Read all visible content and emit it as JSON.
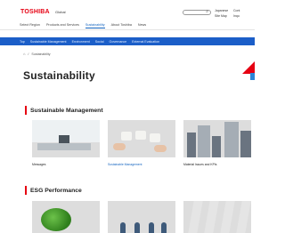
{
  "header": {
    "logo_text": "TOSHIBA",
    "region_label": "Global",
    "search_placeholder": "",
    "utility_links": [
      "Japanese",
      "Site Map",
      "Cont",
      "Inqu"
    ]
  },
  "nav": {
    "items": [
      "Select Region",
      "Products and Services",
      "Sustainability",
      "About Toshiba",
      "News"
    ],
    "active_index": 2
  },
  "subnav": {
    "items": [
      "Top",
      "Sustainable Management",
      "Environment",
      "Social",
      "Governance",
      "External Evaluation"
    ]
  },
  "breadcrumb": {
    "home_icon": "home-icon",
    "current": "Sustainability"
  },
  "page": {
    "title": "Sustainability"
  },
  "sections": [
    {
      "title": "Sustainable Management",
      "cards": [
        {
          "label": "Messages",
          "is_link": false
        },
        {
          "label": "Sustainable Management",
          "is_link": true
        },
        {
          "label": "Material Issues and KPIs",
          "is_link": false
        }
      ]
    },
    {
      "title": "ESG Performance",
      "cards": [
        {
          "label": "",
          "is_link": false
        },
        {
          "label": "",
          "is_link": false
        },
        {
          "label": "",
          "is_link": false
        }
      ]
    }
  ],
  "colors": {
    "brand_red": "#e60012",
    "nav_blue": "#1b5ec8",
    "link_blue": "#1565c0"
  }
}
